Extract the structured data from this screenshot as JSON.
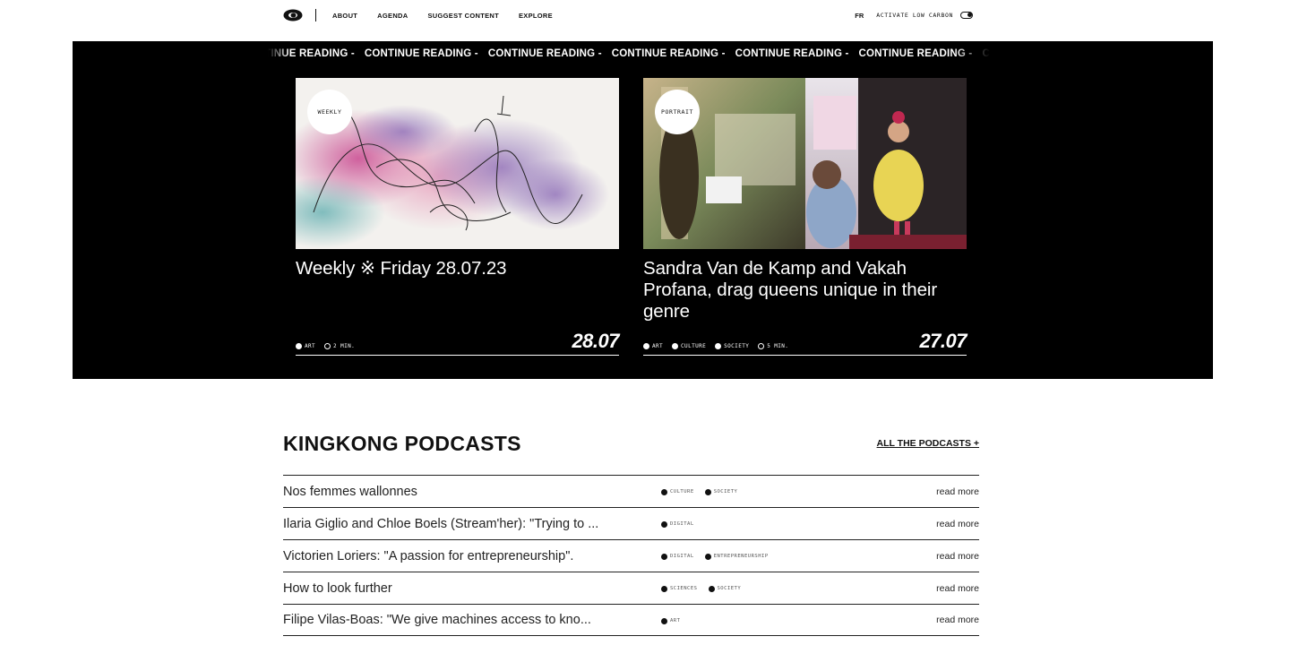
{
  "nav": {
    "links": [
      "ABOUT",
      "AGENDA",
      "SUGGEST CONTENT",
      "EXPLORE"
    ],
    "lang": "FR",
    "low_carbon": "ACTIVATE LOW CARBON"
  },
  "ticker": {
    "label": "CONTINUE READING -"
  },
  "cards": [
    {
      "badge": "WEEKLY",
      "title": "Weekly ※ Friday 28.07.23",
      "tags": [
        "ART"
      ],
      "read_time": "2 MIN.",
      "date": "28.07"
    },
    {
      "badge": "PORTRAIT",
      "title": "Sandra Van de Kamp and Vakah Profana, drag queens unique in their genre",
      "tags": [
        "ART",
        "CULTURE",
        "SOCIETY"
      ],
      "read_time": "5 MIN.",
      "date": "27.07"
    }
  ],
  "podcasts": {
    "title": "KINGKONG PODCASTS",
    "all_link": "ALL THE PODCASTS +",
    "read_more": "read more",
    "items": [
      {
        "title": "Nos femmes wallonnes",
        "tags": [
          "CULTURE",
          "SOCIETY"
        ]
      },
      {
        "title": "Ilaria Giglio and Chloe Boels (Stream'her): \"Trying to ...",
        "tags": [
          "DIGITAL"
        ]
      },
      {
        "title": "Victorien Loriers: \"A passion for entrepreneurship\".",
        "tags": [
          "DIGITAL",
          "ENTREPRENEURSHIP"
        ]
      },
      {
        "title": "How to look further",
        "tags": [
          "SCIENCES",
          "SOCIETY"
        ]
      },
      {
        "title": "Filipe Vilas-Boas: \"We give machines access to kno...",
        "tags": [
          "ART"
        ]
      }
    ]
  }
}
